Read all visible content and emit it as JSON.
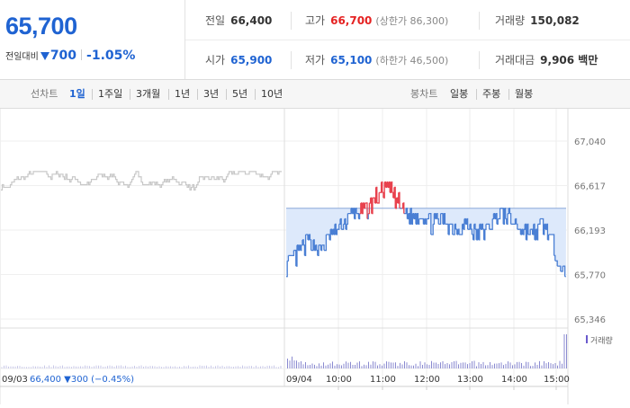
{
  "summary": {
    "price": "65,700",
    "change_label": "전일대비",
    "change": "700",
    "change_pct": "-1.05%",
    "prev_close_label": "전일",
    "prev_close": "66,400",
    "high_label": "고가",
    "high": "66,700",
    "upper_limit": "(상한가 86,300)",
    "volume_label": "거래량",
    "volume": "150,082",
    "open_label": "시가",
    "open": "65,900",
    "low_label": "저가",
    "low": "65,100",
    "lower_limit": "(하한가 46,500)",
    "trade_value_label": "거래대금",
    "trade_value": "9,906 백만",
    "colors": {
      "up": "#e52222",
      "down": "#1f63d2"
    }
  },
  "toolbar": {
    "line_chart_label": "선차트",
    "periods": [
      "1일",
      "1주일",
      "3개월",
      "1년",
      "3년",
      "5년",
      "10년"
    ],
    "active_period": "1일",
    "candle_label": "봉차트",
    "candles": [
      "일봉",
      "주봉",
      "월봉"
    ]
  },
  "chart_data": {
    "type": "line",
    "y_ticks": [
      "67,040",
      "66,617",
      "66,193",
      "65,770",
      "65,346"
    ],
    "ylim": [
      65346,
      67040
    ],
    "reference_price": 66400,
    "prev_day": {
      "date": "09/03",
      "summary": "66,400 ▼300 (−0.45%)",
      "approx_range": [
        66030,
        66760
      ]
    },
    "today": {
      "date": "09/04",
      "x_labels": [
        "10:00",
        "11:00",
        "12:00",
        "13:00",
        "14:00",
        "15:00"
      ],
      "times": [
        "09:00",
        "09:15",
        "09:30",
        "09:45",
        "10:00",
        "10:15",
        "10:30",
        "10:45",
        "11:00",
        "11:15",
        "11:30",
        "11:45",
        "12:00",
        "12:15",
        "12:30",
        "12:45",
        "13:00",
        "13:15",
        "13:30",
        "13:45",
        "14:00",
        "14:15",
        "14:30",
        "14:45",
        "15:00",
        "15:20"
      ],
      "values": [
        65850,
        65950,
        66100,
        66000,
        66150,
        66250,
        66350,
        66380,
        66500,
        66600,
        66450,
        66300,
        66350,
        66250,
        66300,
        66200,
        66250,
        66150,
        66200,
        66350,
        66300,
        66200,
        66150,
        66250,
        66000,
        65700
      ]
    },
    "volume_label": "거래량",
    "colors": {
      "prev_day": "#c8c8c8",
      "below_ref": "#4a7fd4",
      "above_ref": "#e8414d",
      "fill": "#dde9fb",
      "ref_line": "#8ba8d8"
    }
  }
}
